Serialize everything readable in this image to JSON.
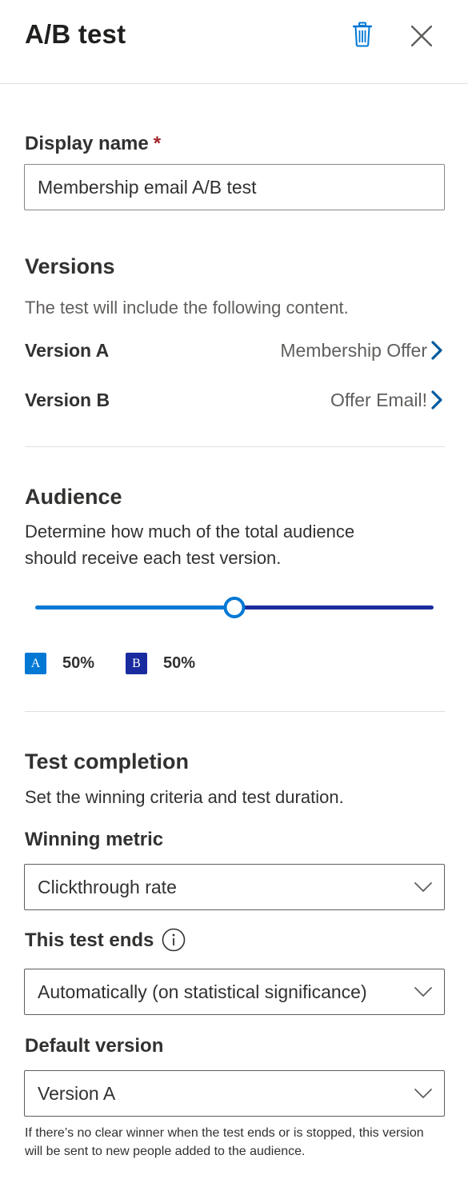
{
  "panel": {
    "title": "A/B test",
    "delete_icon": "trash-icon",
    "close_icon": "close-icon"
  },
  "display_name": {
    "label": "Display name",
    "required_marker": "*",
    "value": "Membership email A/B test"
  },
  "versions": {
    "title": "Versions",
    "description": "The test will include the following content.",
    "items": [
      {
        "label": "Version A",
        "value": "Membership Offer"
      },
      {
        "label": "Version B",
        "value": "Offer Email!"
      }
    ]
  },
  "audience": {
    "title": "Audience",
    "description_line1": "Determine how much of the total audience",
    "description_line2": "should receive each test version.",
    "split_a": 0.5,
    "legend": [
      {
        "badge": "A",
        "percent": "50%",
        "color": "#0078d4"
      },
      {
        "badge": "B",
        "percent": "50%",
        "color": "#1a2b9f"
      }
    ]
  },
  "completion": {
    "title": "Test completion",
    "description": "Set the winning criteria and test duration.",
    "winning_metric": {
      "label": "Winning metric",
      "value": "Clickthrough rate"
    },
    "test_ends": {
      "label": "This test ends",
      "value": "Automatically (on statistical significance)",
      "info_icon": "info-icon"
    },
    "default_version": {
      "label": "Default version",
      "value": "Version A"
    },
    "footnote": "If there’s no clear winner when the test ends or is stopped, this version will be sent to new people added to the audience."
  },
  "colors": {
    "accent": "#0078d4",
    "version_b": "#1a2b9f",
    "required": "#a4262c",
    "link_chevron": "#005a9e"
  }
}
